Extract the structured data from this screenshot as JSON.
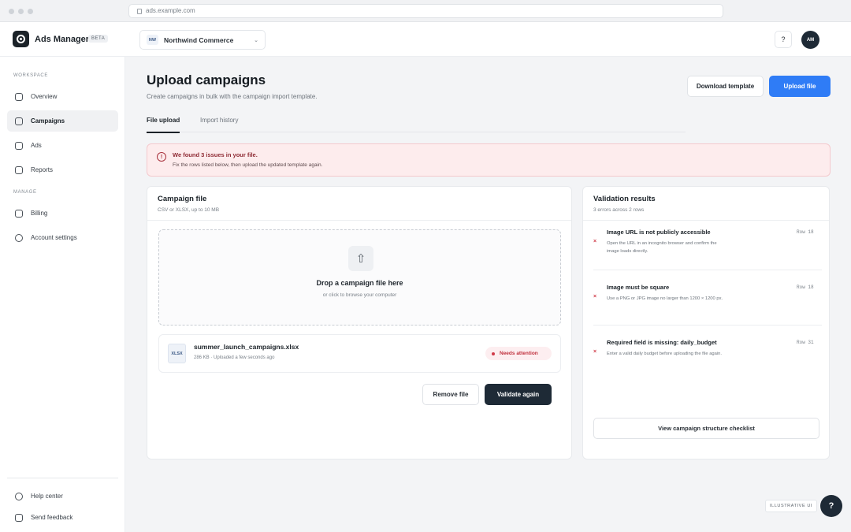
{
  "browser": {
    "url": "ads.example.com"
  },
  "header": {
    "app_name": "Ads Manager",
    "beta_label": "BETA",
    "account_badge": "NW",
    "account_name": "Northwind Commerce",
    "help_label": "?",
    "avatar_initials": "AM"
  },
  "sidebar": {
    "workspace_label": "WORKSPACE",
    "manage_label": "MANAGE",
    "items": [
      {
        "label": "Overview",
        "icon": "square-icon"
      },
      {
        "label": "Campaigns",
        "icon": "square-icon",
        "active": true
      },
      {
        "label": "Ads",
        "icon": "square-icon"
      },
      {
        "label": "Reports",
        "icon": "square-icon"
      },
      {
        "label": "Billing",
        "icon": "square-icon"
      },
      {
        "label": "Account settings",
        "icon": "circle-icon"
      }
    ],
    "footer_items": [
      {
        "label": "Help center",
        "icon": "circle-icon"
      },
      {
        "label": "Send feedback",
        "icon": "square-icon"
      }
    ]
  },
  "page": {
    "title": "Upload campaigns",
    "subtitle": "Create campaigns in bulk with the campaign import template.",
    "download_label": "Download template",
    "upload_label": "Upload file",
    "tabs": [
      {
        "label": "File upload",
        "active": true
      },
      {
        "label": "Import history",
        "active": false
      }
    ]
  },
  "alert": {
    "title": "We found 3 issues in your file.",
    "text": "Fix the rows listed below, then upload the updated template again."
  },
  "campaign_file": {
    "title": "Campaign file",
    "subtitle": "CSV or XLSX, up to 10 MB",
    "drop_title": "Drop a campaign file here",
    "drop_sub": "or click to browse your computer",
    "file": {
      "type": "XLSX",
      "name": "summer_launch_campaigns.xlsx",
      "meta": "286 KB · Uploaded a few seconds ago",
      "status": "Needs attention"
    },
    "remove_label": "Remove file",
    "validate_label": "Validate again"
  },
  "validation": {
    "title": "Validation results",
    "subtitle": "3 errors across 2 rows",
    "issues": [
      {
        "title": "Image URL is not publicly accessible",
        "row": "Row 18",
        "text": "Open the URL in an incognito browser and confirm the image loads directly."
      },
      {
        "title": "Image must be square",
        "row": "Row 18",
        "text": "Use a PNG or JPG image no larger than 1200 × 1200 px."
      },
      {
        "title": "Required field is missing: daily_budget",
        "row": "Row 31",
        "text": "Enter a valid daily budget before uploading the file again."
      }
    ],
    "checklist_label": "View campaign structure checklist"
  },
  "footer": {
    "illustrative_label": "ILLUSTRATIVE UI",
    "fab_label": "?"
  },
  "colors": {
    "primary": "#2f7cf6",
    "dark": "#1e2a36",
    "error": "#d03a48",
    "alert_bg": "#fdeced"
  }
}
